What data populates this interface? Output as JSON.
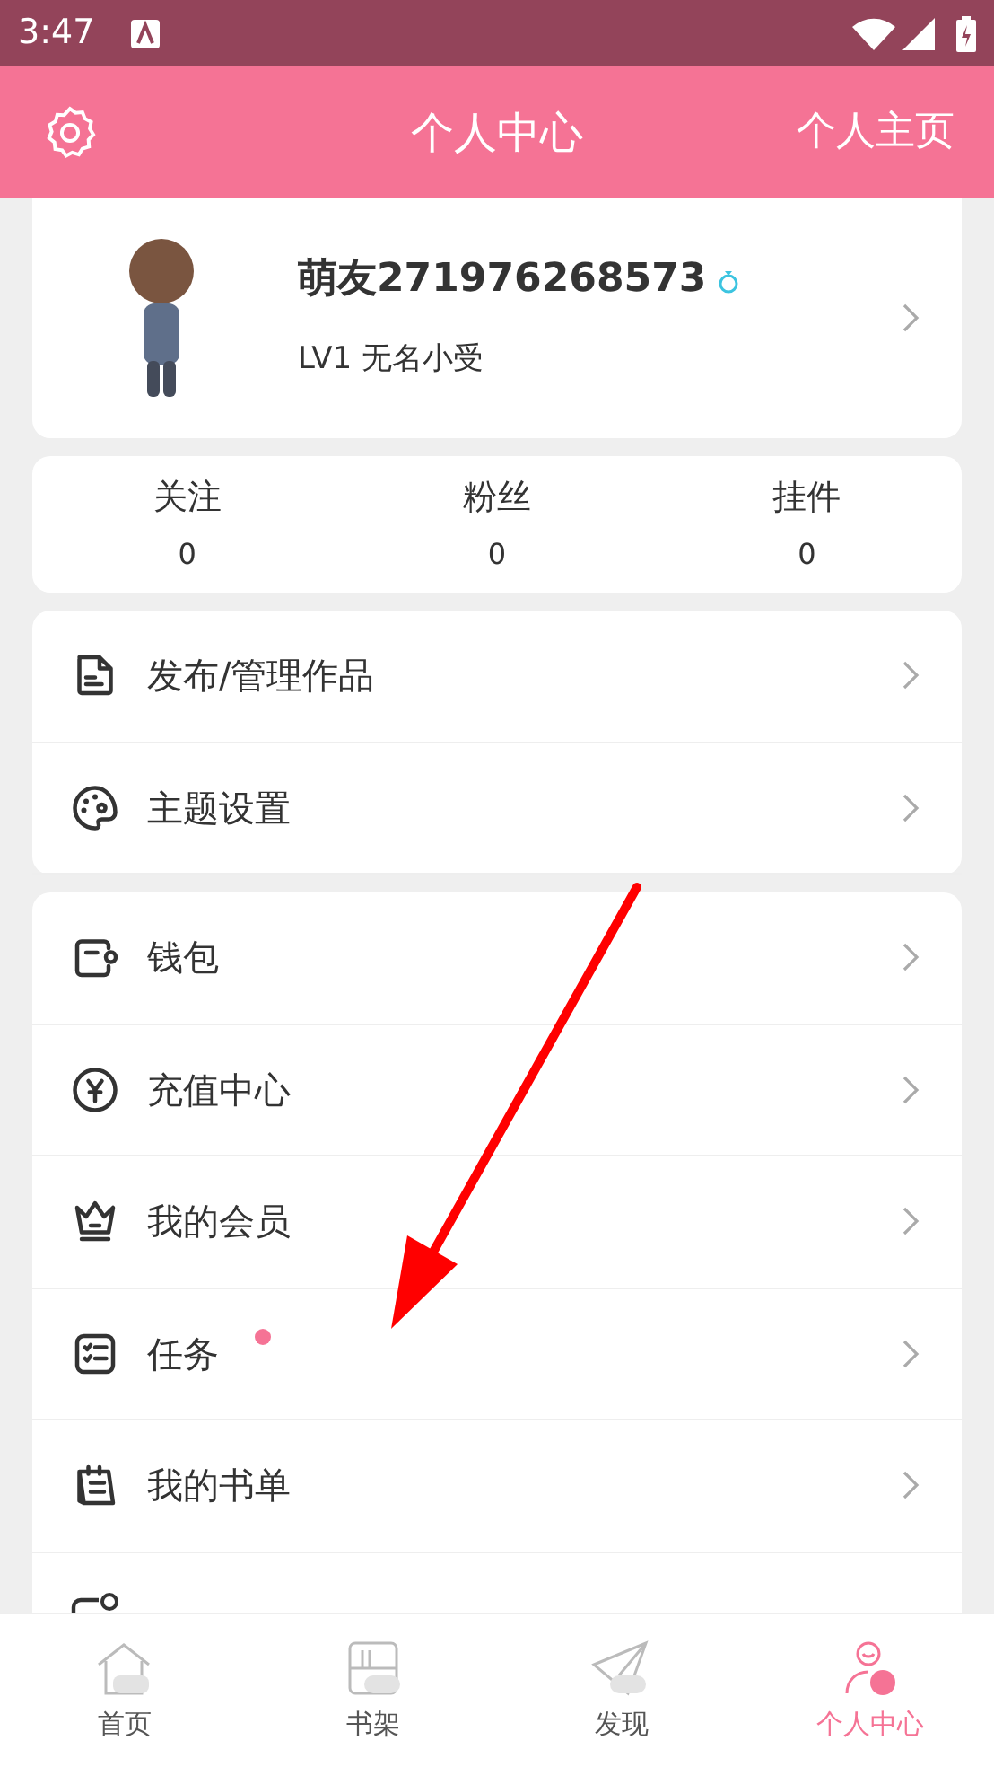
{
  "status_bar": {
    "time": "3:47"
  },
  "header": {
    "title": "个人中心",
    "right_link": "个人主页"
  },
  "profile": {
    "name": "萌友271976268573",
    "level": "LV1 无名小受"
  },
  "stats": [
    {
      "label": "关注",
      "value": "0"
    },
    {
      "label": "粉丝",
      "value": "0"
    },
    {
      "label": "挂件",
      "value": "0"
    }
  ],
  "menu_groups": [
    [
      {
        "label": "发布/管理作品",
        "badge": false
      },
      {
        "label": "主题设置",
        "badge": false
      }
    ],
    [
      {
        "label": "钱包",
        "badge": false
      },
      {
        "label": "充值中心",
        "badge": false
      },
      {
        "label": "我的会员",
        "badge": false
      },
      {
        "label": "任务",
        "badge": true
      },
      {
        "label": "我的书单",
        "badge": false
      }
    ]
  ],
  "bottom_nav": [
    {
      "label": "首页",
      "selected": false
    },
    {
      "label": "书架",
      "selected": false
    },
    {
      "label": "发现",
      "selected": false
    },
    {
      "label": "个人中心",
      "selected": true
    }
  ]
}
